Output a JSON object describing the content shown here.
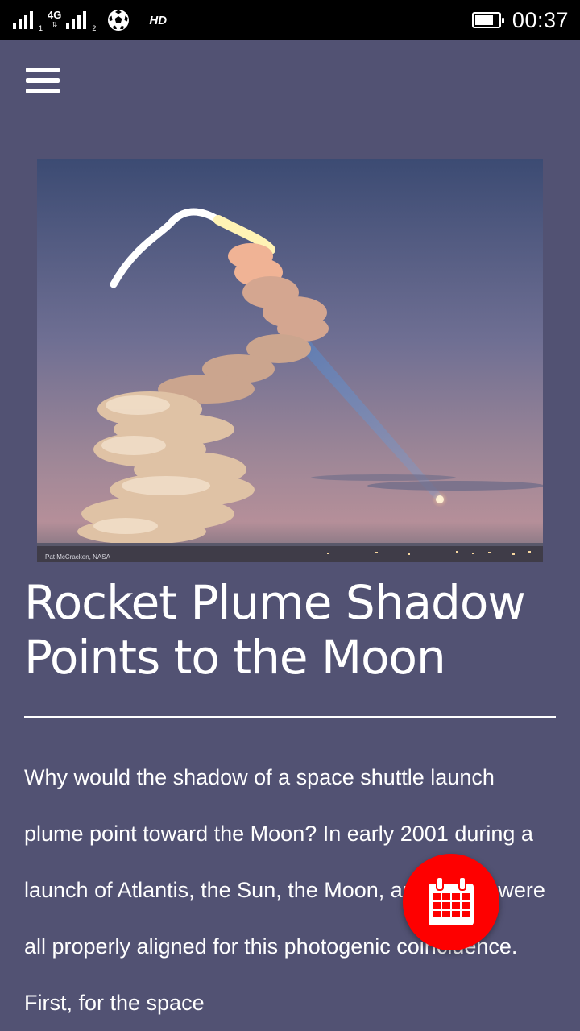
{
  "status_bar": {
    "network": "4G",
    "hd_label": "HD",
    "time": "00:37",
    "battery_level": 0.8,
    "icons": [
      "signal-sim1-icon",
      "signal-sim2-icon",
      "soccer-ball-icon",
      "battery-icon"
    ]
  },
  "nav": {
    "menu_icon": "hamburger-menu-icon"
  },
  "hero": {
    "credit": "Pat McCracken, NASA"
  },
  "article": {
    "title": "Rocket Plume Shadow Points to the Moon",
    "body": "Why would the shadow of a space shuttle launch plume point toward the Moon? In early 2001 during a launch of Atlantis, the Sun, the Moon, and rocket were all properly aligned for this photogenic coincidence. First, for the space"
  },
  "fab": {
    "icon": "calendar-icon",
    "color": "#fe0000"
  },
  "colors": {
    "background": "#525273",
    "text": "#ffffff",
    "status_bar": "#000000"
  }
}
